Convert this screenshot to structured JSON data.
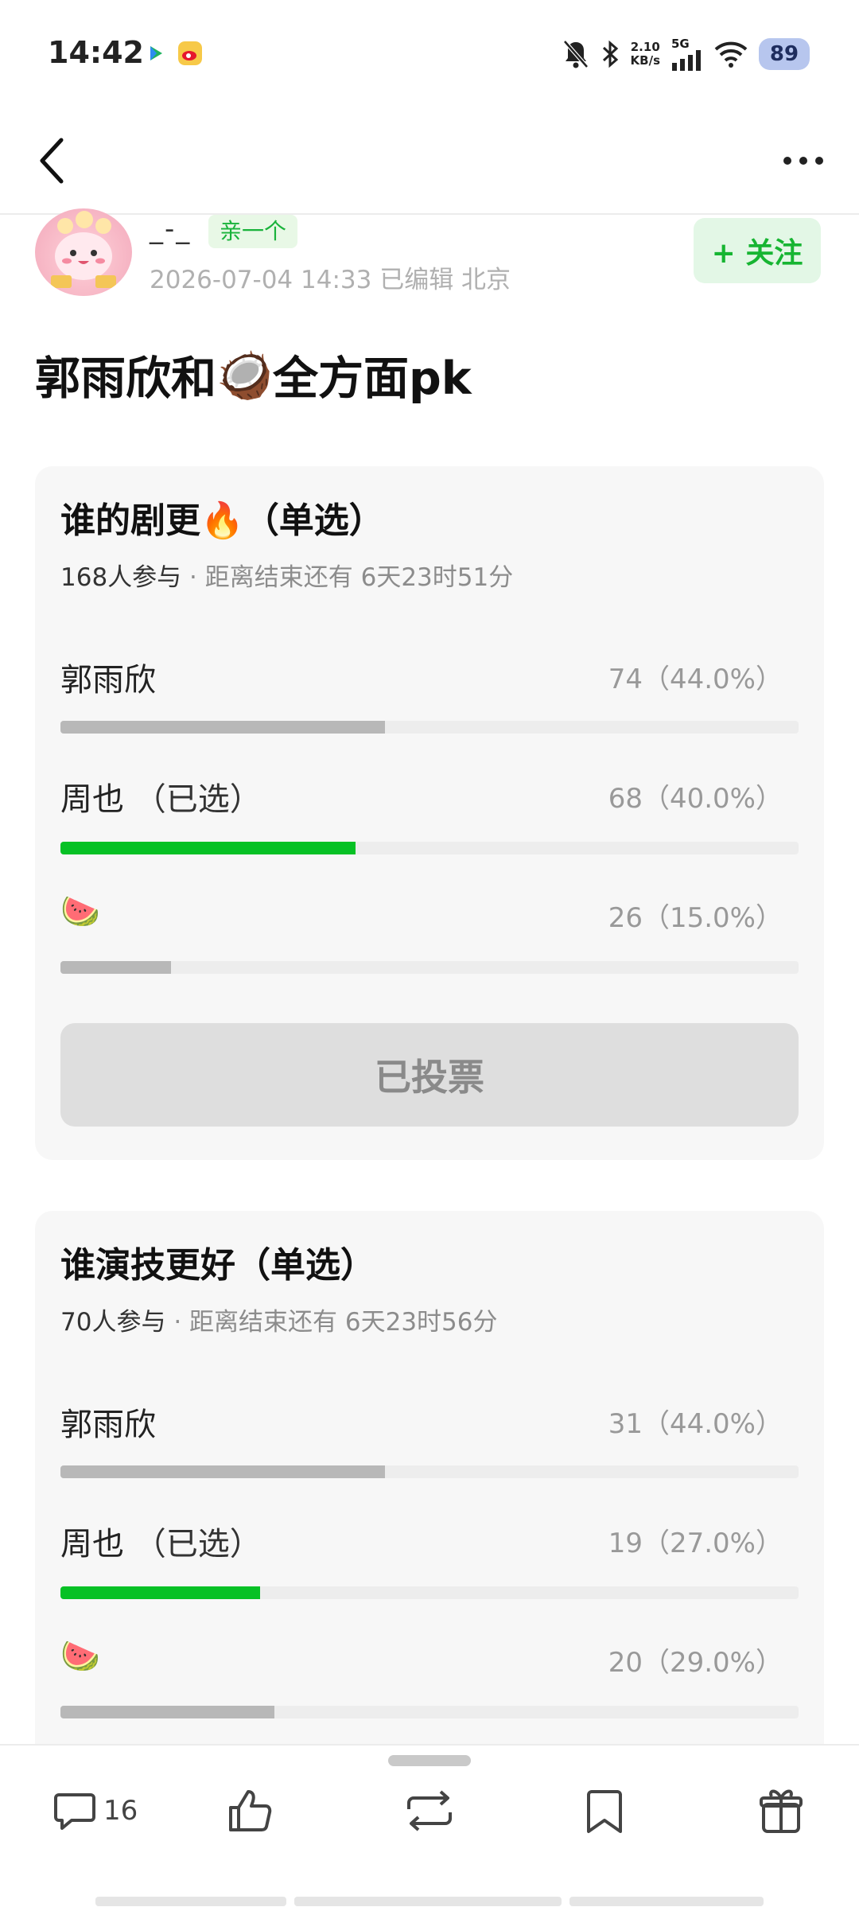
{
  "status": {
    "time": "14:42",
    "speed_value": "2.10",
    "speed_unit": "KB/s",
    "network": "5G",
    "battery": "89",
    "icons": [
      "video-app-icon",
      "weibo-app-icon",
      "mute-icon",
      "bluetooth-icon",
      "signal-icon",
      "wifi-icon",
      "battery-icon"
    ]
  },
  "author": {
    "name": "_-_",
    "badge": "亲一个",
    "meta": "2026-07-04 14:33  已编辑  北京",
    "follow_label": "+ 关注"
  },
  "post": {
    "title_prefix": "郭雨欣和",
    "title_emoji": "🥥",
    "title_suffix": "全方面pk"
  },
  "polls": [
    {
      "question": "谁的剧更🔥（单选）",
      "participants": "168人参与",
      "deadline": "· 距离结束还有 6天23时51分",
      "options": [
        {
          "label": "郭雨欣",
          "selected_label": "",
          "count": "74（44.0%）",
          "fraction": 0.44,
          "selected": false
        },
        {
          "label": "周也",
          "selected_label": "（已选）",
          "count": "68（40.0%）",
          "fraction": 0.4,
          "selected": true
        },
        {
          "label": "🍉",
          "selected_label": "",
          "count": "26（15.0%）",
          "fraction": 0.15,
          "selected": false
        }
      ],
      "voted_label": "已投票"
    },
    {
      "question": "谁演技更好（单选）",
      "participants": "70人参与",
      "deadline": "· 距离结束还有 6天23时56分",
      "options": [
        {
          "label": "郭雨欣",
          "selected_label": "",
          "count": "31（44.0%）",
          "fraction": 0.44,
          "selected": false
        },
        {
          "label": "周也",
          "selected_label": "（已选）",
          "count": "19（27.0%）",
          "fraction": 0.27,
          "selected": true
        },
        {
          "label": "🍉",
          "selected_label": "",
          "count": "20（29.0%）",
          "fraction": 0.29,
          "selected": false
        }
      ]
    }
  ],
  "bottom": {
    "comment_count": "16",
    "icons": [
      "comment-icon",
      "like-icon",
      "repost-icon",
      "bookmark-icon",
      "gift-icon"
    ]
  },
  "colors": {
    "accent": "#07c125",
    "follow_bg": "#e3f7e6",
    "bar_gray": "#b8b8b8"
  }
}
